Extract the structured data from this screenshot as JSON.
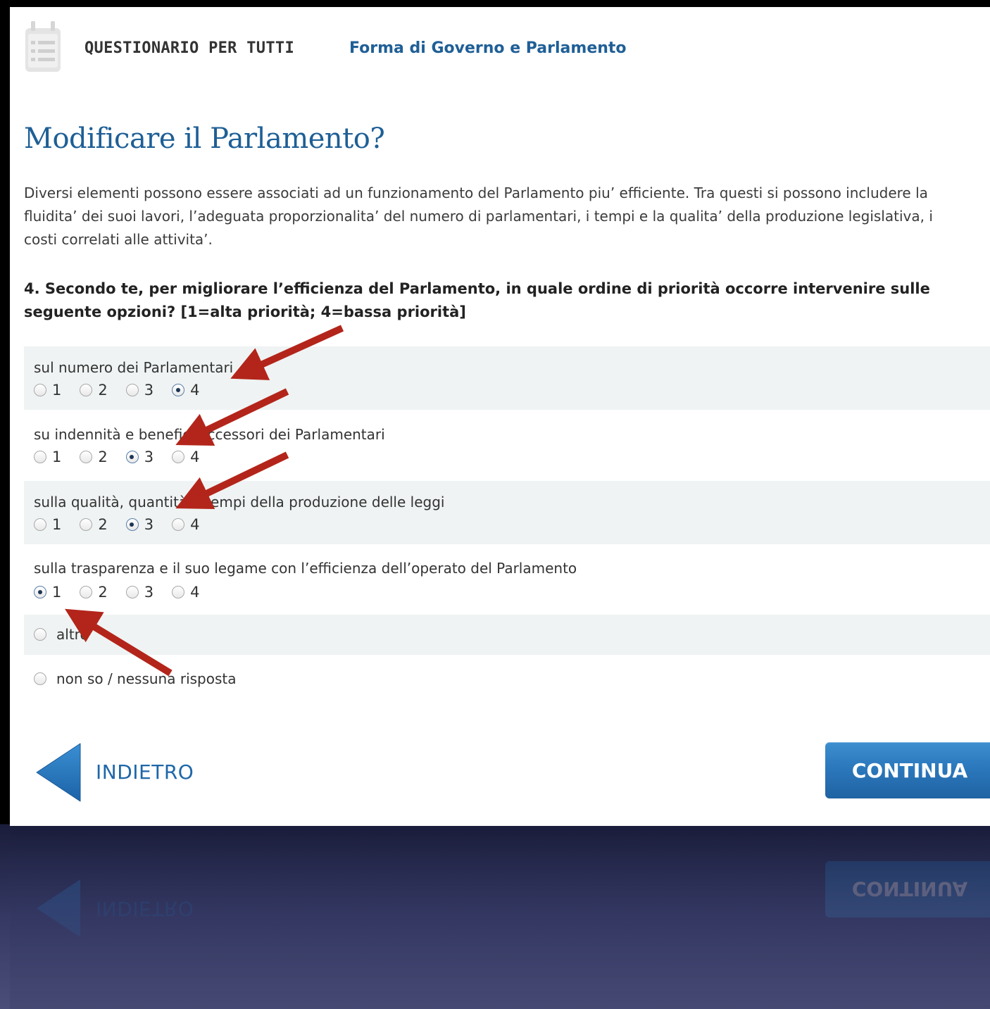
{
  "header": {
    "brand": "QUESTIONARIO PER TUTTI",
    "section": "Forma di Governo e Parlamento",
    "icon": "questionnaire-calendar-icon"
  },
  "page": {
    "title": "Modificare il Parlamento?",
    "intro": "Diversi elementi possono essere associati ad un funzionamento del Parlamento piu’ efficiente. Tra questi si possono includere la fluidita’ dei suoi lavori, l’adeguata proporzionalita’ del numero di parlamentari, i tempi e la qualita’ della produzione legislativa, i costi correlati alle attivita’.",
    "question": "4. Secondo te, per migliorare l’efficienza del Parlamento, in quale ordine di priorità occorre intervenire sulle seguente opzioni? [1=alta priorità; 4=bassa priorità]"
  },
  "rows": [
    {
      "label": "sul numero dei Parlamentari",
      "options": [
        "1",
        "2",
        "3",
        "4"
      ],
      "selected": "4"
    },
    {
      "label": "su indennità e benefici accessori dei Parlamentari",
      "options": [
        "1",
        "2",
        "3",
        "4"
      ],
      "selected": "3"
    },
    {
      "label": "sulla qualità, quantità e tempi della produzione delle leggi",
      "options": [
        "1",
        "2",
        "3",
        "4"
      ],
      "selected": "3"
    },
    {
      "label": "sulla trasparenza e il suo legame con l’efficienza dell’operato del Parlamento",
      "options": [
        "1",
        "2",
        "3",
        "4"
      ],
      "selected": "1"
    }
  ],
  "single_options": [
    {
      "label": "altro",
      "selected": false
    },
    {
      "label": "non so / nessuna risposta",
      "selected": false
    }
  ],
  "nav": {
    "back_label": "INDIETRO",
    "continue_label": "CONTINUA",
    "back_icon": "back-arrow-icon"
  },
  "colors": {
    "accent": "#1e5f96",
    "button": "#2b78bc",
    "annotation_arrow": "#b3251a"
  }
}
